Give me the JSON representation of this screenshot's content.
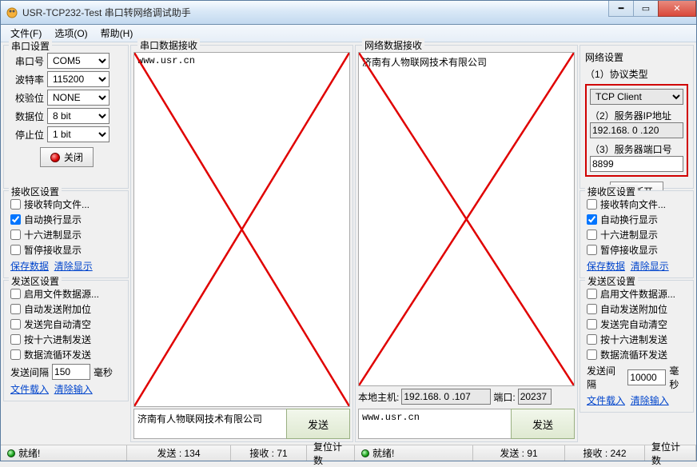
{
  "window": {
    "title": "USR-TCP232-Test 串口转网络调试助手"
  },
  "menu": {
    "file": "文件(F)",
    "options": "选项(O)",
    "help": "帮助(H)"
  },
  "serial": {
    "title": "串口设置",
    "port_lbl": "串口号",
    "port": "COM5",
    "baud_lbl": "波特率",
    "baud": "115200",
    "parity_lbl": "校验位",
    "parity": "NONE",
    "data_lbl": "数据位",
    "data": "8 bit",
    "stop_lbl": "停止位",
    "stop": "1 bit",
    "close": "关闭"
  },
  "recv_opts_l": {
    "title": "接收区设置",
    "to_file": "接收转向文件...",
    "wrap": "自动换行显示",
    "hex": "十六进制显示",
    "pause": "暂停接收显示",
    "save": "保存数据",
    "clear": "清除显示"
  },
  "send_opts_l": {
    "title": "发送区设置",
    "from_file": "启用文件数据源...",
    "auto_suffix": "自动发送附加位",
    "clear_after": "发送完自动清空",
    "hex_send": "按十六进制发送",
    "loop": "数据流循环发送",
    "interval_lbl": "发送间隔",
    "interval": "150",
    "ms": "毫秒",
    "load": "文件载入",
    "clearin": "清除输入"
  },
  "mid_left": {
    "title": "串口数据接收",
    "recv": "www.usr.cn",
    "send_text": "济南有人物联网技术有限公司",
    "send_btn": "发送"
  },
  "mid_right": {
    "title": "网络数据接收",
    "recv": "济南有人物联网技术有限公司",
    "host_lbl": "本地主机:",
    "host": "192.168. 0 .107",
    "port_lbl": "端口:",
    "port": "20237",
    "send_text": "www.usr.cn",
    "send_btn": "发送"
  },
  "net": {
    "title": "网络设置",
    "proto_lbl": "（1）协议类型",
    "proto": "TCP Client",
    "ip_lbl": "（2）服务器IP地址",
    "ip": "192.168. 0 .120",
    "port_lbl": "（3）服务器端口号",
    "port": "8899",
    "disconnect": "断开"
  },
  "recv_opts_r": {
    "title": "接收区设置",
    "to_file": "接收转向文件...",
    "wrap": "自动换行显示",
    "hex": "十六进制显示",
    "pause": "暂停接收显示",
    "save": "保存数据",
    "clear": "清除显示"
  },
  "send_opts_r": {
    "title": "发送区设置",
    "from_file": "启用文件数据源...",
    "auto_suffix": "自动发送附加位",
    "clear_after": "发送完自动清空",
    "hex_send": "按十六进制发送",
    "loop": "数据流循环发送",
    "interval_lbl": "发送间隔",
    "interval": "10000",
    "ms": "毫秒",
    "load": "文件载入",
    "clearin": "清除输入"
  },
  "status": {
    "ready_l": "就绪!",
    "send_l": "发送 : 134",
    "recv_l": "接收 : 71",
    "reset_l": "复位计数",
    "ready_r": "就绪!",
    "send_r": "发送 : 91",
    "recv_r": "接收 : 242",
    "reset_r": "复位计数"
  }
}
